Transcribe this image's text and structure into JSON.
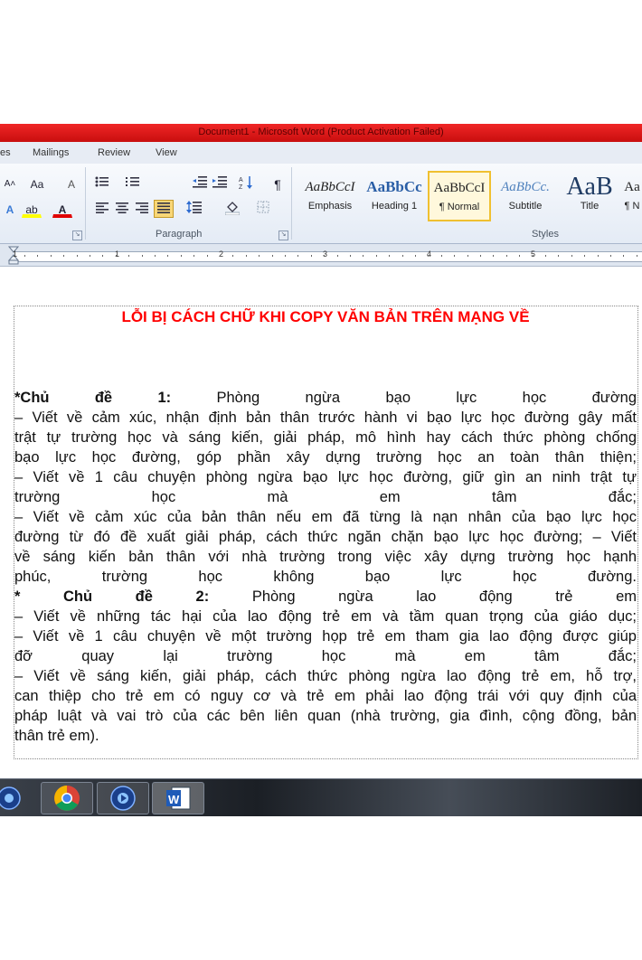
{
  "window": {
    "title": "Document1  -  Microsoft Word (Product Activation Failed)"
  },
  "ribbon_tabs": [
    {
      "label": "es"
    },
    {
      "label": "Mailings"
    },
    {
      "label": "Review"
    },
    {
      "label": "View"
    }
  ],
  "font_group": {
    "grow_label": "A˄",
    "change_case_label": "Aa",
    "clear_label": "A",
    "text_effects_label": "A",
    "highlight_label": "ab",
    "font_color_label": "A"
  },
  "paragraph_group": {
    "label": "Paragraph",
    "pilcrow": "¶"
  },
  "styles_group": {
    "label": "Styles",
    "items": [
      {
        "preview": "AaBbCcI",
        "name": "Emphasis"
      },
      {
        "preview": "AaBbCc",
        "name": "Heading 1"
      },
      {
        "preview": "AaBbCcI",
        "name": "¶ Normal"
      },
      {
        "preview": "AaBbCc.",
        "name": "Subtitle"
      },
      {
        "preview": "AaB",
        "name": "Title"
      },
      {
        "preview": "Aa",
        "name": "¶ N"
      }
    ]
  },
  "ruler": {
    "numbers": [
      "1",
      "1",
      "2",
      "3",
      "4",
      "5"
    ]
  },
  "document": {
    "title": "LỖI BỊ CÁCH CHỮ KHI COPY VĂN BẢN TRÊN MẠNG VỀ",
    "lines": [
      {
        "bold": "*Chủ đề 1:",
        "text": " Phòng ngừa bạo lực học đường"
      },
      {
        "text": "– Viết về cảm xúc, nhận định bản thân trước hành vi bạo lực học đường gây mất"
      },
      {
        "text": "trật tự trường học và sáng kiến, giải pháp, mô hình hay cách thức phòng chống"
      },
      {
        "text": "bạo lực học đường, góp phần xây dựng trường học an toàn thân thiện;"
      },
      {
        "text": "– Viết về 1 câu chuyện phòng ngừa bạo lực học đường, giữ gìn an ninh trật tự"
      },
      {
        "text": "trường học mà em tâm đắc;"
      },
      {
        "text": "– Viết về cảm xúc của bản thân nếu em đã từng là nạn nhân của bạo lực học"
      },
      {
        "text": "đường từ đó đề xuất giải pháp, cách thức ngăn chặn bạo lực học đường; – Viết"
      },
      {
        "text": "về sáng kiến bản thân với nhà trường trong việc xây dựng trường học hạnh"
      },
      {
        "text": "phúc, trường học không bạo lực học đường."
      },
      {
        "bold": "* Chủ đề 2:",
        "text": " Phòng ngừa lao động trẻ em"
      },
      {
        "text": "– Viết về những tác hại của lao động trẻ em và tầm quan trọng của giáo dục;"
      },
      {
        "text": "– Viết về 1 câu chuyện về một trường họp trẻ em tham gia lao động được giúp"
      },
      {
        "text": "đỡ quay lại trường học mà em tâm đắc;"
      },
      {
        "text": "– Viết về sáng kiến, giải pháp, cách thức phòng ngừa lao động trẻ em, hỗ trợ,"
      },
      {
        "text": "can thiệp cho trẻ em có nguy cơ và trẻ em phải lao động trái với quy định của"
      },
      {
        "text": "pháp luật và vai trò của các bên liên quan (nhà trường, gia đình, cộng đồng, bản"
      },
      {
        "text": "thân trẻ em)."
      }
    ]
  },
  "taskbar": {
    "apps": [
      {
        "name": "media-player"
      },
      {
        "name": "chrome"
      },
      {
        "name": "media-player"
      },
      {
        "name": "word"
      }
    ]
  },
  "colors": {
    "title_bar": "#e01818",
    "doc_title": "#ff0000",
    "ribbon_bg": "#e4ebf5"
  }
}
